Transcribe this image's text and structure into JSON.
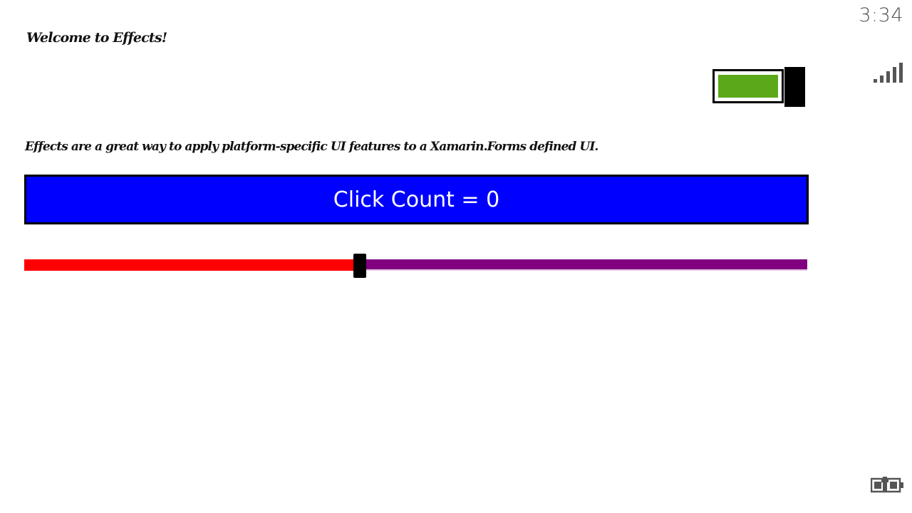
{
  "status_bar": {
    "time": "3:34",
    "signal_icon": "signal-bars-icon",
    "battery_icon": "battery-charging-icon"
  },
  "app": {
    "welcome_text": "Welcome to Effects!",
    "description_text": "Effects are a great way to apply platform-specific UI features to a Xamarin.Forms defined UI.",
    "toggle": {
      "state": "on",
      "on_color": "#5ba918",
      "thumb_color": "#000000"
    },
    "button": {
      "label": "Click Count = 0",
      "background": "#0000ff",
      "text_color": "#ffffff"
    },
    "slider": {
      "value": 0.42,
      "min_track_color": "#ff0000",
      "max_track_color": "#800080",
      "thumb_color": "#000000"
    }
  }
}
